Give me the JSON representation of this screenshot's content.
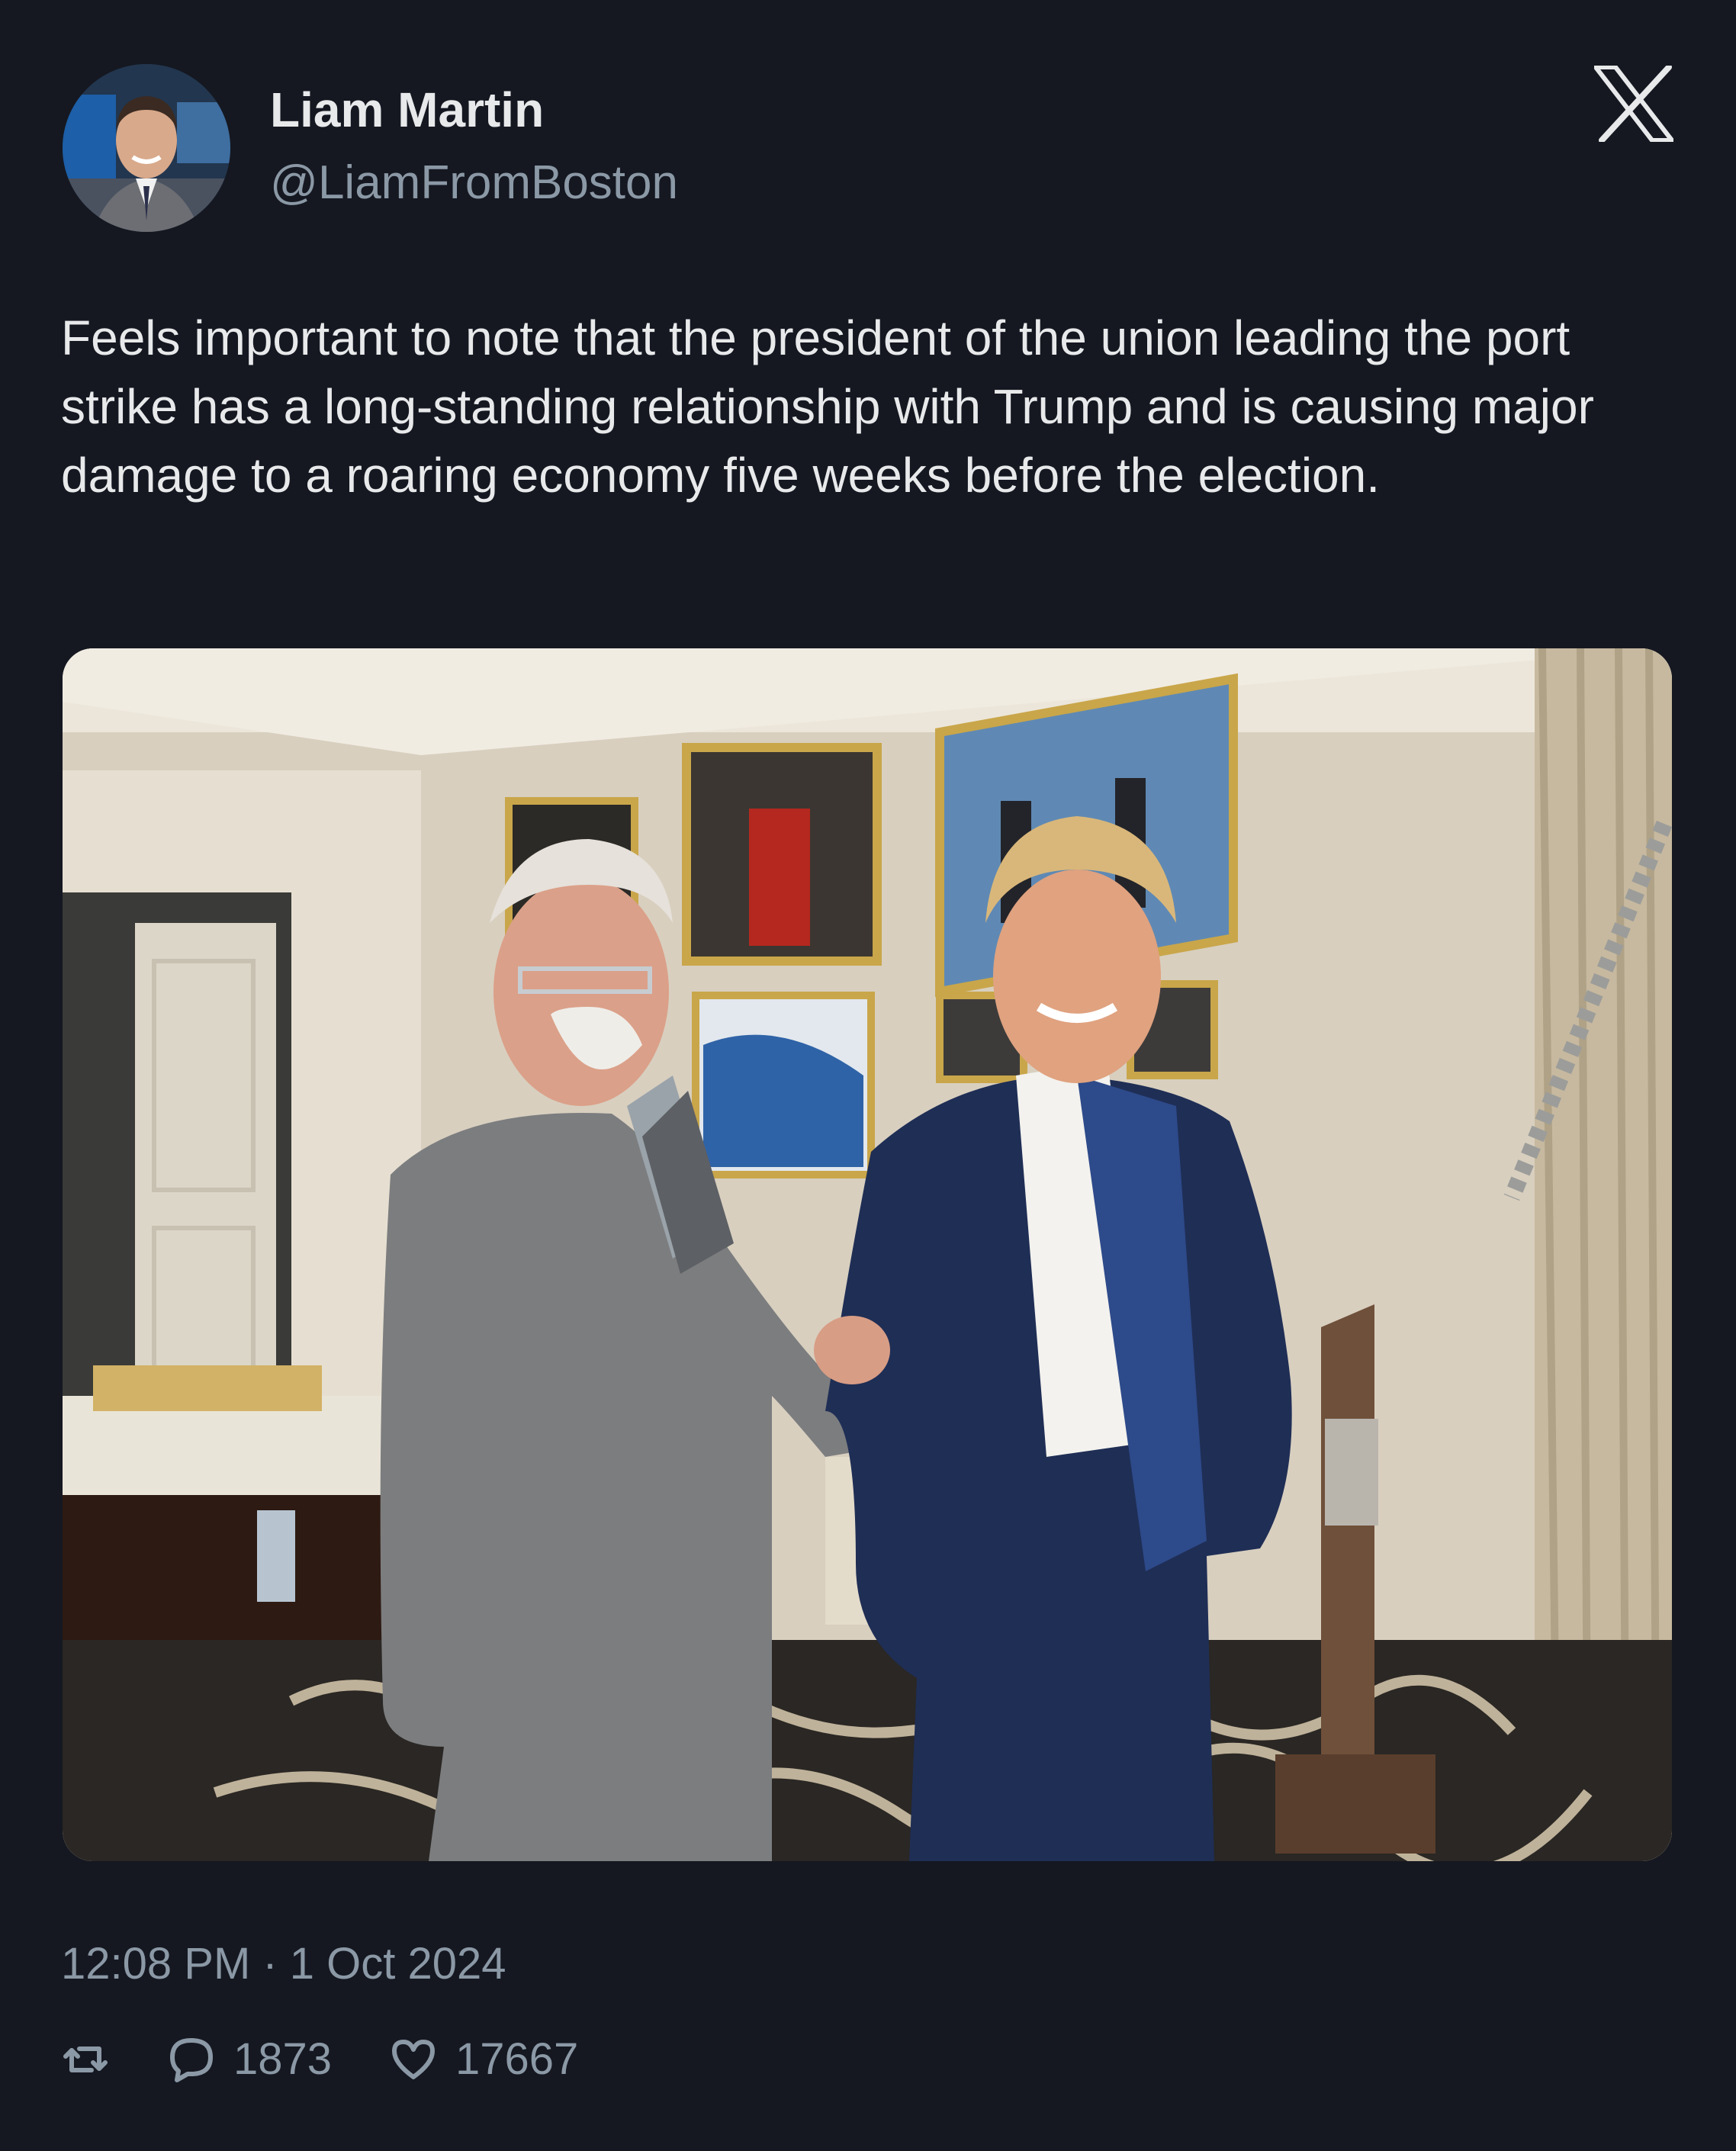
{
  "author": {
    "name": "Liam Martin",
    "handle": "@LiamFromBoston",
    "avatar_icon": "avatar-photo"
  },
  "brand_icon": "x-logo-icon",
  "tweet": {
    "text": "Feels important to note that the president of the union leading the port strike has a long-standing relationship with Trump and is causing major damage to a roaring economy five weeks before the election.",
    "media_icon": "attached-photo"
  },
  "timestamp": "12:08 PM · 1 Oct 2024",
  "actions": {
    "retweet": {
      "icon": "retweet-icon"
    },
    "reply": {
      "icon": "reply-icon",
      "count": "1873"
    },
    "like": {
      "icon": "heart-icon",
      "count": "17667"
    }
  },
  "colors": {
    "background": "#151821",
    "text": "#e7e9ea",
    "muted": "#8b98a5"
  }
}
